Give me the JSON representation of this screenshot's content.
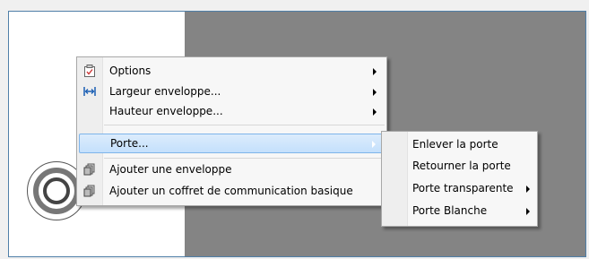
{
  "menu": {
    "items": [
      {
        "label": "Options",
        "icon": "checklist-icon",
        "submenu": true
      },
      {
        "label": "Largeur enveloppe...",
        "icon": "width-arrows-icon",
        "submenu": true
      },
      {
        "label": "Hauteur enveloppe...",
        "icon": "",
        "submenu": true
      },
      {
        "label": "Porte...",
        "icon": "",
        "submenu": true,
        "highlighted": true
      },
      {
        "label": "Ajouter une enveloppe",
        "icon": "stack-icon",
        "submenu": false
      },
      {
        "label": "Ajouter un coffret de communication basique",
        "icon": "stack-icon",
        "submenu": false
      }
    ]
  },
  "submenu": {
    "items": [
      {
        "label": "Enlever la porte",
        "submenu": false
      },
      {
        "label": "Retourner la porte",
        "submenu": false
      },
      {
        "label": "Porte transparente",
        "submenu": true
      },
      {
        "label": "Porte Blanche",
        "submenu": true
      }
    ]
  },
  "colors": {
    "highlight": "#cce4fc",
    "canvas_gray": "#848484",
    "frame_border": "#4f7fa8"
  }
}
